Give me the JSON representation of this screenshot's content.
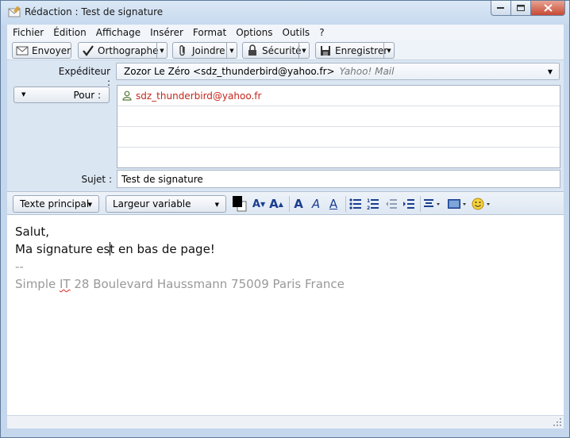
{
  "window": {
    "title": "Rédaction : Test de signature"
  },
  "menu": {
    "items": [
      {
        "label": "Fichier"
      },
      {
        "label": "Édition"
      },
      {
        "label": "Affichage"
      },
      {
        "label": "Insérer"
      },
      {
        "label": "Format"
      },
      {
        "label": "Options"
      },
      {
        "label": "Outils"
      },
      {
        "label": "?"
      }
    ]
  },
  "toolbar": {
    "send_label": "Envoyer",
    "spell_label": "Orthographe",
    "attach_label": "Joindre",
    "security_label": "Sécurité",
    "save_label": "Enregistrer"
  },
  "header": {
    "sender_label": "Expéditeur :",
    "sender_value": "Zozor Le Zéro <sdz_thunderbird@yahoo.fr>",
    "sender_account": "Yahoo! Mail",
    "to_label": "Pour :",
    "recipients": [
      "sdz_thunderbird@yahoo.fr"
    ],
    "subject_label": "Sujet :",
    "subject_value": "Test de signature"
  },
  "format": {
    "paragraph_style": "Texte principal",
    "font": "Largeur variable"
  },
  "body": {
    "line1": "Salut,",
    "line2_before_caret": "Ma signature es",
    "line2_after_caret": "t en bas de page!",
    "sig_separator": "--",
    "sig_word1": "Simple",
    "sig_word2": "IT",
    "sig_rest": " 28 Boulevard Haussmann 75009 Paris France"
  },
  "colors": {
    "recipient_text": "#c4261d",
    "signature_text": "#999999",
    "window_frame": "#c4d7ec"
  }
}
